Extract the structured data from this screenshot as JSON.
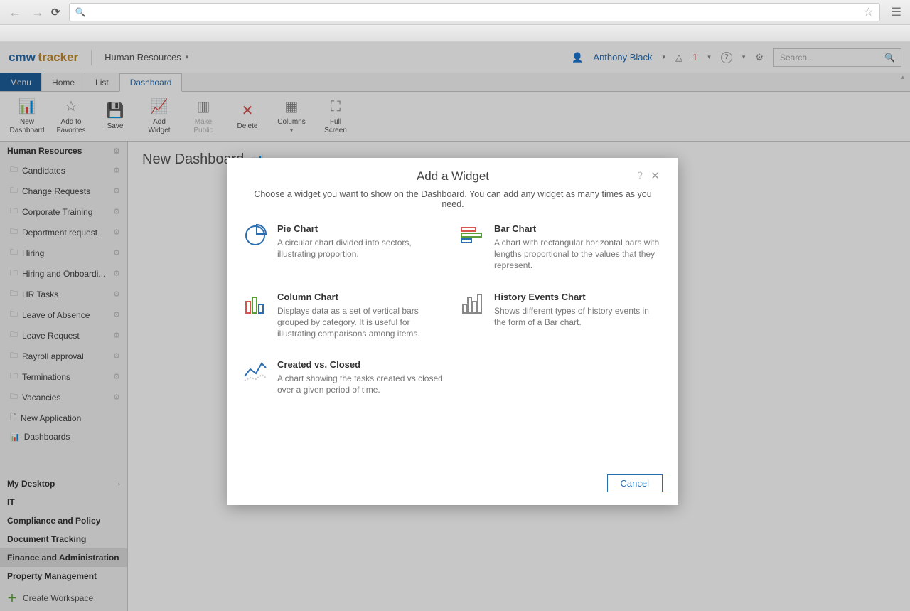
{
  "workspace": "Human Resources",
  "user": "Anthony Black",
  "notif_count": "1",
  "search_placeholder": "Search...",
  "tabs": {
    "menu": "Menu",
    "home": "Home",
    "list": "List",
    "dashboard": "Dashboard"
  },
  "ribbon": {
    "new_dashboard": "New\nDashboard",
    "add_favorites": "Add to\nFavorites",
    "save": "Save",
    "add_widget": "Add\nWidget",
    "make_public": "Make\nPublic",
    "delete": "Delete",
    "columns": "Columns",
    "full_screen": "Full\nScreen"
  },
  "sidebar": {
    "section": "Human Resources",
    "items": [
      "Candidates",
      "Change Requests",
      "Corporate Training",
      "Department request",
      "Hiring",
      "Hiring and Onboardi...",
      "HR Tasks",
      "Leave of Absence",
      "Leave Request",
      "Rayroll approval",
      "Terminations",
      "Vacancies"
    ],
    "new_app": "New Application",
    "dashboards": "Dashboards",
    "bottom": [
      "My Desktop",
      "IT",
      "Compliance and Policy",
      "Document Tracking",
      "Finance and Administration",
      "Property Management"
    ],
    "create": "Create Workspace"
  },
  "dashboard_title": "New Dashboard",
  "modal": {
    "title": "Add a Widget",
    "desc": "Choose a widget you want to show on the Dashboard. You can add any widget as many times as you need.",
    "widgets": {
      "pie": {
        "title": "Pie Chart",
        "desc": "A circular chart divided into sectors, illustrating proportion."
      },
      "bar": {
        "title": "Bar Chart",
        "desc": "A chart with rectangular horizontal bars with lengths proportional to the values that they represent."
      },
      "column": {
        "title": "Column Chart",
        "desc": "Displays data as a set of vertical bars grouped by category. It is useful for illustrating comparisons among items."
      },
      "history": {
        "title": "History Events Chart",
        "desc": "Shows different types of history events in the form of a Bar chart."
      },
      "cvc": {
        "title": "Created vs. Closed",
        "desc": "A chart showing the tasks created vs closed over a given period of time."
      }
    },
    "cancel": "Cancel"
  }
}
